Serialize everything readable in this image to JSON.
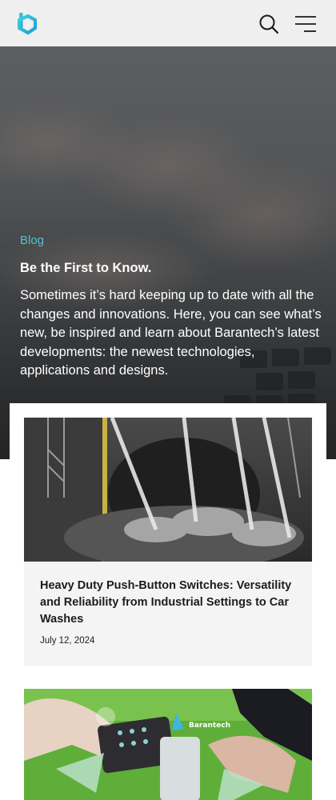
{
  "header": {
    "logo_icon": "barantech-logo-icon",
    "search_icon": "search-icon",
    "menu_icon": "menu-icon",
    "accent_color": "#27c0d0"
  },
  "hero": {
    "kicker": "Blog",
    "title": "Be the First to Know.",
    "text": "Sometimes it’s hard keeping up to date with all the changes and innovations. Here, you can see what’s new, be inspired and learn about Barantech’s latest developments: the newest technologies, applications and designs."
  },
  "posts": [
    {
      "title": "Heavy Duty Push-Button Switches: Versatility and Reliability from Industrial Settings to Car Washes",
      "date": "July 12, 2024"
    },
    {
      "image_brand_text": "Barantech"
    }
  ]
}
